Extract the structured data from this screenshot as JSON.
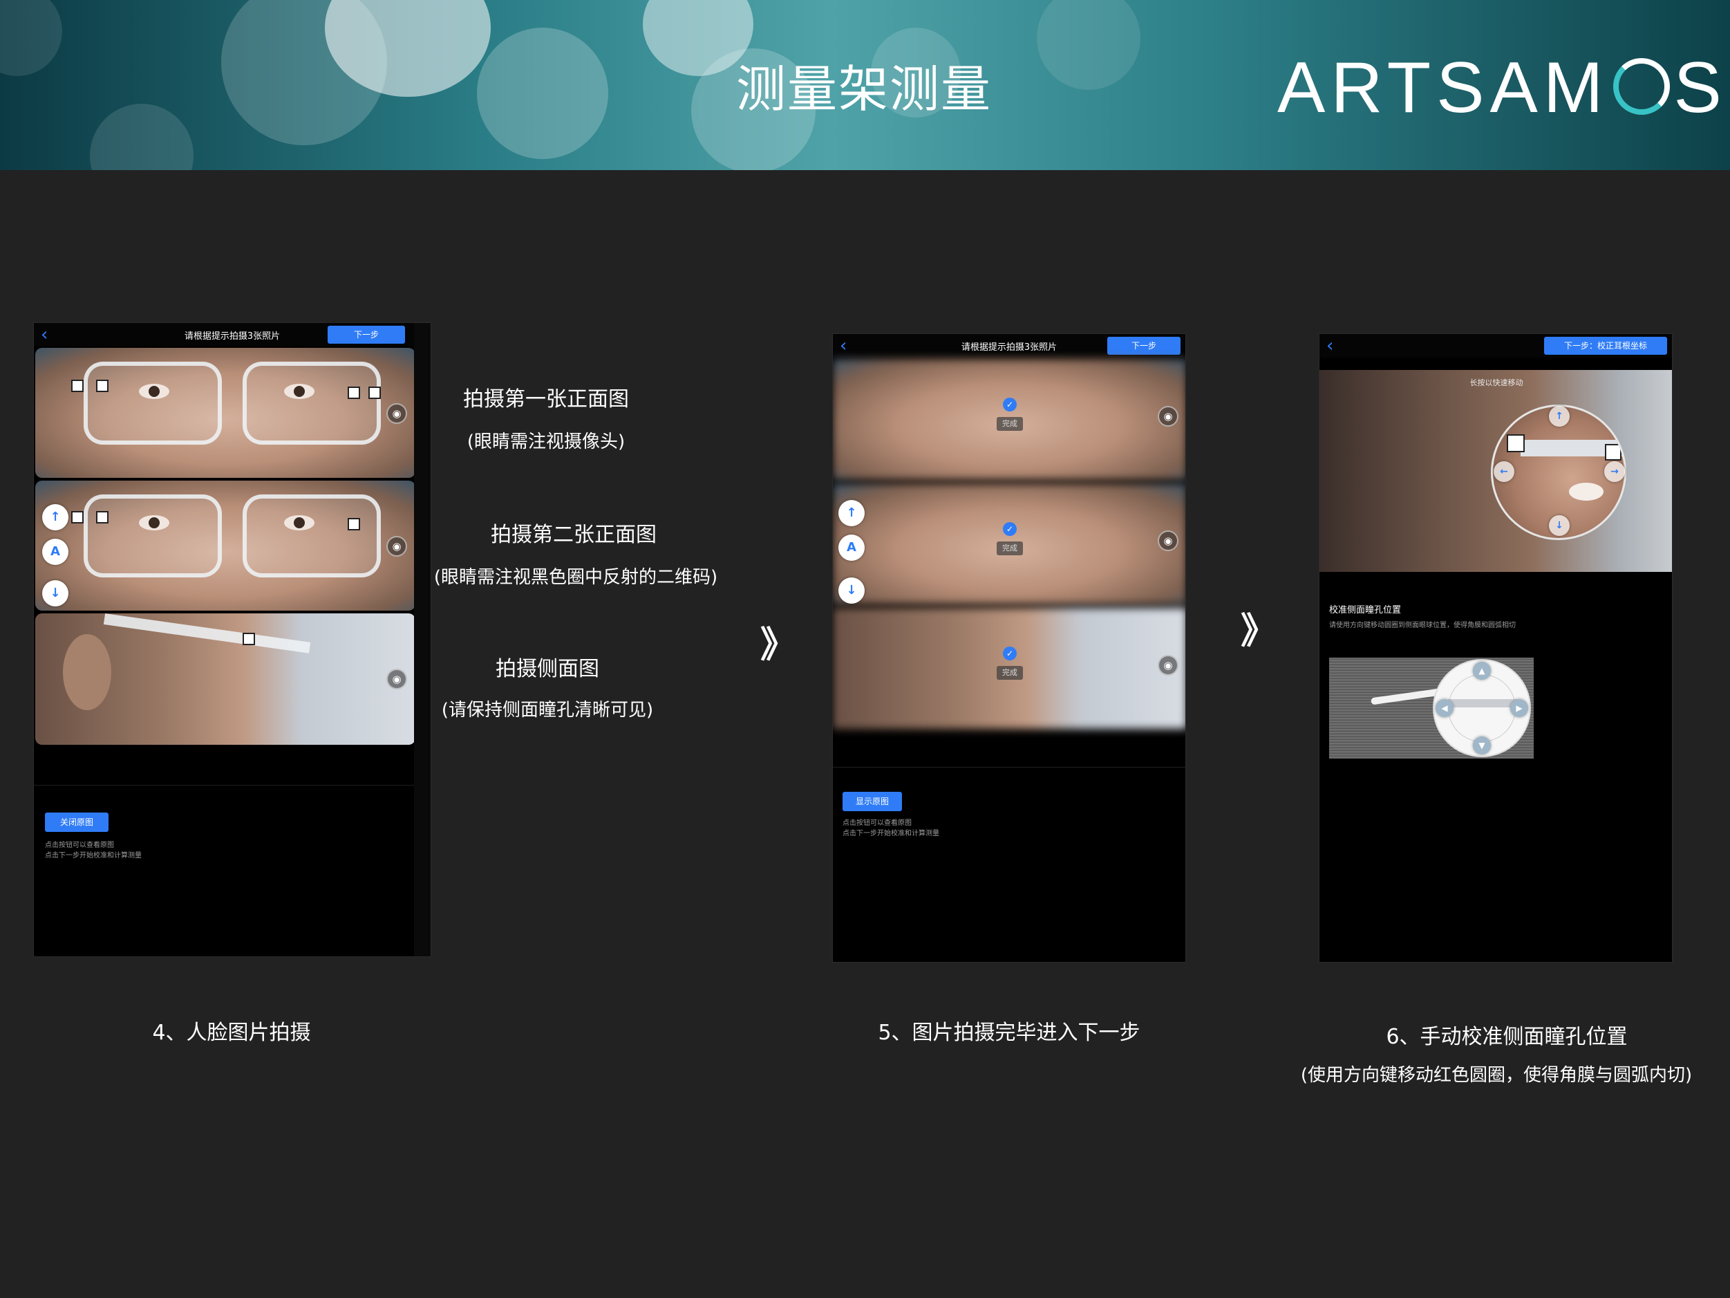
{
  "header": {
    "title": "测量架测量",
    "logo_before": "ARTSAM",
    "logo_after": "S"
  },
  "panel1": {
    "nav_title": "请根据提示拍摄3张照片",
    "next_label": "下一步",
    "close_label": "关闭原图",
    "hint_lines": [
      "点击按钮可以查看原图",
      "点击下一步开始校准和计算测量"
    ],
    "ctrl_up": "↑",
    "ctrl_auto": "A",
    "ctrl_down": "↓"
  },
  "panel2": {
    "nav_title": "请根据提示拍摄3张照片",
    "next_label": "下一步",
    "done_label": "完成",
    "show_label": "显示原图",
    "hint_lines": [
      "点击按钮可以查看原图",
      "点击下一步开始校准和计算测量"
    ],
    "ctrl_up": "↑",
    "ctrl_auto": "A",
    "ctrl_down": "↓"
  },
  "panel3": {
    "next_label": "下一步：校正耳根坐标",
    "long_press": "长按以快速移动",
    "section_title": "校准侧面瞳孔位置",
    "section_hint": "请使用方向键移动圆圈到侧面眼球位置，使得角膜和圆弧相切"
  },
  "notes": {
    "shot1_title": "拍摄第一张正面图",
    "shot1_sub": "(眼睛需注视摄像头)",
    "shot2_title": "拍摄第二张正面图",
    "shot2_sub": "(眼睛需注视黑色圈中反射的二维码)",
    "shot3_title": "拍摄侧面图",
    "shot3_sub": "(请保持侧面瞳孔清晰可见)"
  },
  "steps": {
    "step4": "4、人脸图片拍摄",
    "step5": "5、图片拍摄完毕进入下一步",
    "step6": "6、手动校准侧面瞳孔位置",
    "step6_sub": "(使用方向键移动红色圆圈，使得角膜与圆弧内切)"
  },
  "arrows": {
    "a1": "》",
    "a2": "》"
  },
  "colors": {
    "accent": "#2f7cf6",
    "background": "#222223",
    "logo_accent": "#38c3c6"
  }
}
